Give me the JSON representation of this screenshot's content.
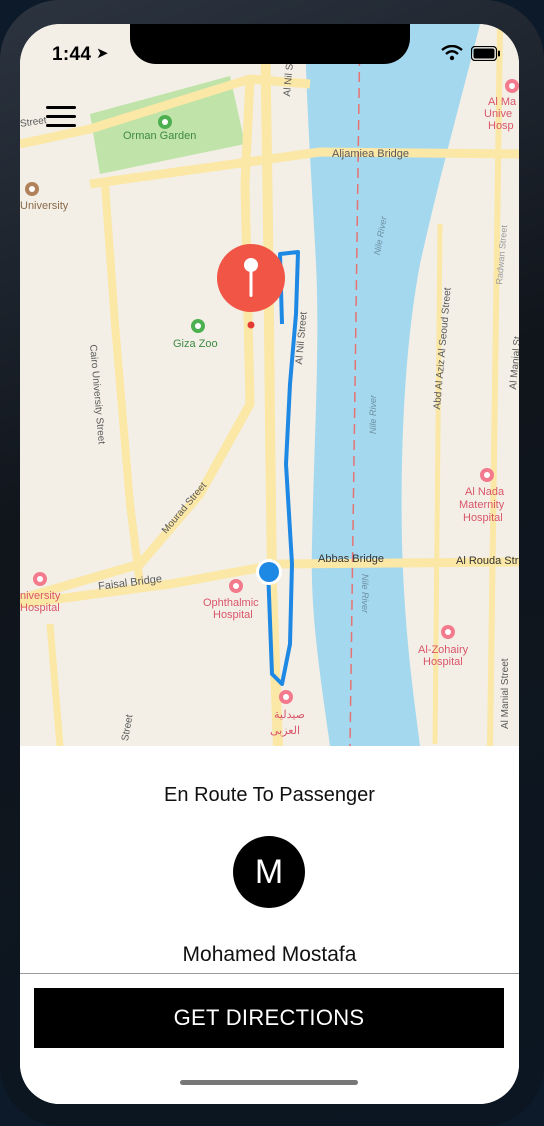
{
  "status_bar": {
    "time": "1:44"
  },
  "map": {
    "labels": {
      "street_left": "Street",
      "orman_garden": "Orman Garden",
      "university": "University",
      "al_nil_street": "Al Nil Street",
      "al_nil_street_2": "Al Nil Street",
      "aljamiea_bridge": "Aljamiea Bridge",
      "giza_zoo": "Giza Zoo",
      "cairo_university_street": "Cairo University Street",
      "mourad_street": "Mourad Street",
      "nile_river_1": "Nile River",
      "nile_river_2": "Nile River",
      "nile_river_3": "Nile River",
      "abd_al_aziz": "Abd Al Aziz Al Seoud Street",
      "radwan_street": "Radwan Street",
      "al_manial_1": "Al Manial St",
      "al_manial_2": "Al Manial Street",
      "al_nada_1": "Al Nada",
      "al_nada_2": "Maternity",
      "al_nada_3": "Hospital",
      "abbas_bridge": "Abbas Bridge",
      "al_rouda": "Al Rouda Str",
      "faisal_bridge": "Faisal Bridge",
      "univ_hosp_1": "niversity",
      "univ_hosp_2": "Hospital",
      "ophthalmic_1": "Ophthalmic",
      "ophthalmic_2": "Hospital",
      "al_zohairy_1": "Al-Zohairy",
      "al_zohairy_2": "Hospital",
      "pharmacy_1": "صيدلية",
      "pharmacy_2": "العزبى",
      "street_bottom": "Street",
      "top_right_1": "Al Ma",
      "top_right_2": "Unive",
      "top_right_3": "Hosp"
    },
    "colors": {
      "land": "#f3efe6",
      "water": "#a4d8ee",
      "road": "#fbe7a6",
      "route": "#1e88e5",
      "pin": "#f05545"
    }
  },
  "panel": {
    "status": "En Route To Passenger",
    "avatar_initial": "M",
    "driver_name": "Mohamed Mostafa",
    "directions_button": "GET DIRECTIONS"
  }
}
